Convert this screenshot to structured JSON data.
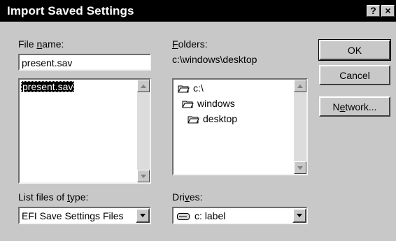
{
  "window": {
    "title": "Import Saved Settings",
    "help_glyph": "?",
    "close_glyph": "×"
  },
  "file_name": {
    "label_before": "File ",
    "label_accel": "n",
    "label_after": "ame:",
    "value": "present.sav"
  },
  "file_list": {
    "items": [
      "present.sav"
    ],
    "selected": "present.sav"
  },
  "folders": {
    "label_accel": "F",
    "label_after": "olders:",
    "current_path": "c:\\windows\\desktop",
    "tree": [
      "c:\\",
      "windows",
      "desktop"
    ]
  },
  "file_type": {
    "label_before": "List files of ",
    "label_accel": "t",
    "label_after": "ype:",
    "value": "EFI Save Settings Files"
  },
  "drives": {
    "label_before": "Dri",
    "label_accel": "v",
    "label_after": "es:",
    "value": "c: label"
  },
  "buttons": {
    "ok": "OK",
    "cancel": "Cancel",
    "network_before": "N",
    "network_accel": "e",
    "network_after": "twork..."
  },
  "colors": {
    "title_bg": "#000000",
    "dialog_bg": "#c8c8c8",
    "field_bg": "#ffffff"
  }
}
